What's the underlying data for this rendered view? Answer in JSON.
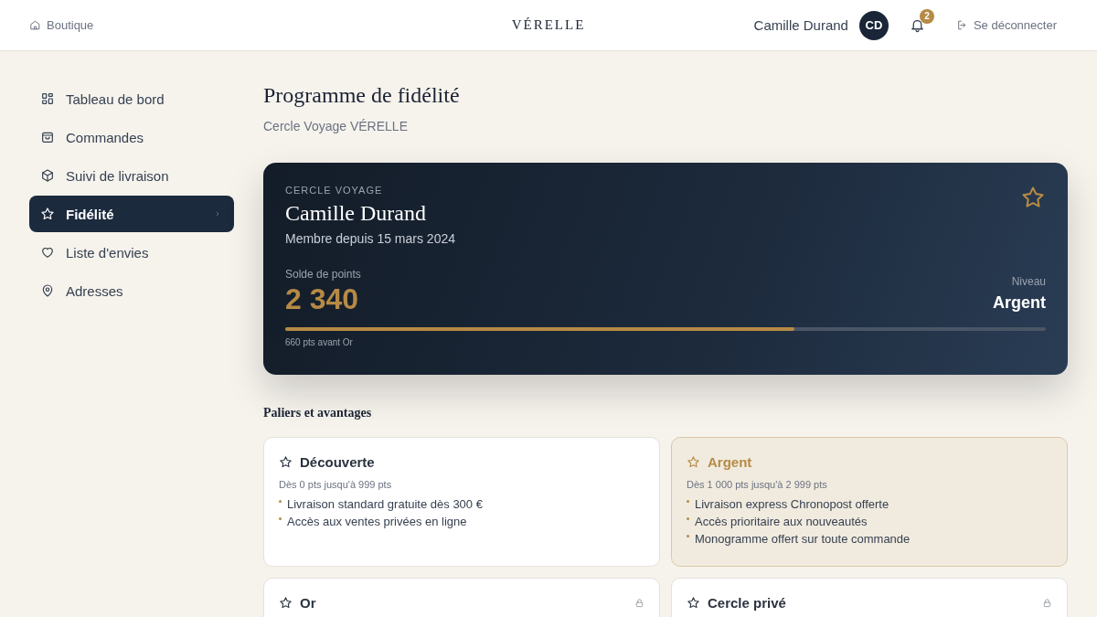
{
  "header": {
    "shop_link": "Boutique",
    "brand": "VÉRELLE",
    "user_name": "Camille Durand",
    "avatar_initials": "CD",
    "notification_count": "2",
    "logout": "Se déconnecter"
  },
  "sidebar": {
    "items": [
      {
        "label": "Tableau de bord",
        "selected": false
      },
      {
        "label": "Commandes",
        "selected": false
      },
      {
        "label": "Suivi de livraison",
        "selected": false
      },
      {
        "label": "Fidélité",
        "selected": true
      },
      {
        "label": "Liste d'envies",
        "selected": false
      },
      {
        "label": "Adresses",
        "selected": false
      }
    ]
  },
  "page": {
    "title": "Programme de fidélité",
    "subtitle": "Cercle Voyage VÉRELLE"
  },
  "member_card": {
    "eyebrow": "CERCLE VOYAGE",
    "name": "Camille Durand",
    "since": "Membre depuis 15 mars 2024",
    "balance_label": "Solde de points",
    "balance": "2 340",
    "tier_label": "Niveau",
    "tier": "Argent",
    "level": 0.67,
    "progress_note": "660 pts avant Or"
  },
  "tiers_heading": "Paliers et avantages",
  "tiers": [
    {
      "name": "Découverte",
      "range": "Dès 0 pts jusqu'à 999 pts",
      "current": false,
      "locked": false,
      "benefits": [
        "Livraison standard gratuite dès 300 €",
        "Accès aux ventes privées en ligne"
      ]
    },
    {
      "name": "Argent",
      "range": "Dès 1 000 pts jusqu'à 2 999 pts",
      "current": true,
      "locked": false,
      "benefits": [
        "Livraison express Chronopost offerte",
        "Accès prioritaire aux nouveautés",
        "Monogramme offert sur toute commande"
      ]
    },
    {
      "name": "Or",
      "current": false,
      "locked": true
    },
    {
      "name": "Cercle privé",
      "current": false,
      "locked": true
    }
  ]
}
